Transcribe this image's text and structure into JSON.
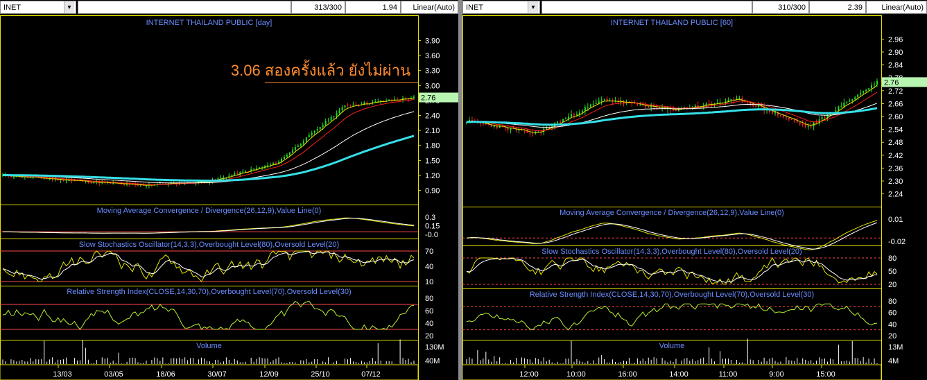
{
  "colors": {
    "bg": "#000000",
    "frame": "#e6e000",
    "candle_up": "#22dd22",
    "candle_down": "#ee2222",
    "title": "#6a8dff",
    "label": "#ffffff",
    "ma_white": "#ffffff",
    "ma_red": "#ff2020",
    "ma_yellow": "#e6e600",
    "ma_cyan": "#35e0e8",
    "macd": "#e6e600",
    "rsi": "#b8f030",
    "annotation": "#ff8c2e",
    "price_tag": "#b7f5b0"
  },
  "left": {
    "symbol": "INET",
    "count": "313/300",
    "value": "1.94",
    "scale": "Linear(Auto)",
    "title": "INTERNET THAILAND PUBLIC [day]",
    "price_label": "2.76",
    "annotation": "3.06 สองครั้งแล้ว ยังไม่ผ่าน",
    "price_ticks": [
      "3.90",
      "3.60",
      "3.30",
      "3.00",
      "2.70",
      "2.40",
      "2.10",
      "1.80",
      "1.50",
      "1.20",
      "0.90"
    ],
    "macd_title": "Moving Average Convergence / Divergence(26,12,9),Value Line(0)",
    "macd_ticks": [
      "0.3",
      "0.15",
      "-0.0"
    ],
    "stoch_title": "Slow Stochastics Oscillator(14,3,3),Overbought Level(80),Oversold Level(20)",
    "stoch_ticks": [
      "70",
      "40",
      "10"
    ],
    "rsi_title": "Relative Strength Index(CLOSE,14,30,70),Overbought Level(70),Oversold Level(30)",
    "rsi_ticks": [
      "80",
      "60",
      "40",
      "20"
    ],
    "vol_title": "Volume",
    "vol_ticks": [
      "130M",
      "40M"
    ],
    "dates": [
      "13/03",
      "03/05",
      "18/06",
      "30/07",
      "12/09",
      "25/10",
      "07/12"
    ]
  },
  "right": {
    "symbol": "INET",
    "count": "310/300",
    "value": "2.39",
    "scale": "Linear(Auto)",
    "title": "INTERNET THAILAND PUBLIC [60]",
    "price_label": "2.76",
    "price_ticks": [
      "2.96",
      "2.90",
      "2.84",
      "2.78",
      "2.72",
      "2.66",
      "2.60",
      "2.54",
      "2.48",
      "2.42",
      "2.36",
      "2.30",
      "2.24"
    ],
    "macd_title": "Moving Average Convergence / Divergence(26,12,9),Value Line(0)",
    "macd_ticks": [
      "0.01",
      "-0.02"
    ],
    "stoch_title": "Slow Stochastics Oscillator(14,3,3),Overbought Level(80),Oversold Level(20)",
    "stoch_ticks": [
      "80",
      "50",
      "20"
    ],
    "rsi_title": "Relative Strength Index(CLOSE,14,30,70),Overbought Level(70),Oversold Level(30)",
    "rsi_ticks": [
      "80",
      "60",
      "40",
      "20"
    ],
    "vol_title": "Volume",
    "vol_ticks": [
      "13M",
      "4M"
    ],
    "times": [
      "12:00",
      "10:00",
      "16:00",
      "14:00",
      "11:00",
      "9:00",
      "15:00"
    ]
  },
  "chart_data": [
    {
      "type": "line",
      "title": "INTERNET THAILAND PUBLIC [day]",
      "ylim": [
        0.7,
        4.1
      ],
      "x": [
        "13/03",
        "03/05",
        "18/06",
        "30/07",
        "12/09",
        "25/10",
        "07/12"
      ],
      "series": [
        {
          "values": [
            1.2,
            1.1,
            1.0,
            1.08,
            1.45,
            2.6,
            2.76
          ]
        }
      ],
      "annotations": [
        {
          "y": 3.06,
          "text": "3.06 สองครั้งแล้ว ยังไม่ผ่าน"
        }
      ]
    },
    {
      "type": "line",
      "title": "INTERNET THAILAND PUBLIC [60]",
      "ylim": [
        2.2,
        3.0
      ],
      "x": [
        "12:00",
        "10:00",
        "16:00",
        "14:00",
        "11:00",
        "9:00",
        "15:00"
      ],
      "series": [
        {
          "values": [
            2.58,
            2.52,
            2.68,
            2.63,
            2.68,
            2.55,
            2.76
          ]
        }
      ]
    }
  ]
}
